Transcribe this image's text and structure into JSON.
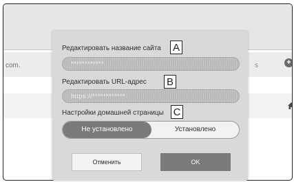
{
  "background": {
    "url_fragment": "com.",
    "right_fragment": "s"
  },
  "dialog": {
    "site_name": {
      "label": "Редактировать название сайта",
      "value": "************",
      "callout": "A"
    },
    "url": {
      "label": "Редактировать URL-адрес",
      "value": "https://************",
      "callout": "B"
    },
    "home_page": {
      "label": "Настройки домашней страницы",
      "callout": "C",
      "options": [
        "Не установлено",
        "Установлено"
      ],
      "selected": "Не установлено"
    },
    "cancel_label": "Отменить",
    "ok_label": "OK"
  },
  "colors": {
    "dialog_bg": "#d9d9d9",
    "selected_toggle": "#7a7a7a",
    "ok_button": "#7a7a7a"
  }
}
